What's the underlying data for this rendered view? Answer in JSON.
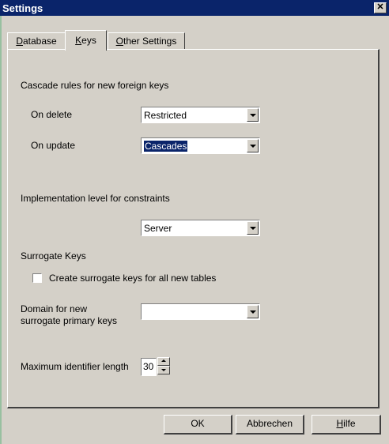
{
  "window": {
    "title": "Settings",
    "close_glyph": "✕"
  },
  "tabs": [
    {
      "label": "Database",
      "accel": "D",
      "rest": "atabase",
      "active": false
    },
    {
      "label": "Keys",
      "accel": "K",
      "rest": "eys",
      "active": true
    },
    {
      "label": "Other Settings",
      "accel": "O",
      "rest": "ther Settings",
      "active": false
    }
  ],
  "keys": {
    "cascade_heading": "Cascade rules for new foreign keys",
    "on_delete_label": "On delete",
    "on_delete_value": "Restricted",
    "on_update_label": "On update",
    "on_update_value": "Cascades",
    "impl_heading": "Implementation level for constraints",
    "impl_value": "Server",
    "surrogate_heading": "Surrogate Keys",
    "surrogate_checkbox_label": "Create surrogate keys for all new tables",
    "surrogate_checked": false,
    "domain_label_line1": "Domain for new",
    "domain_label_line2": "surrogate primary keys",
    "domain_value": "",
    "max_len_label": "Maximum identifier length",
    "max_len_value": "30"
  },
  "buttons": {
    "ok": "OK",
    "cancel": "Abbrechen",
    "help_accel": "H",
    "help_rest": "ilfe"
  },
  "icons": [
    "close-icon",
    "dropdown-arrow-icon",
    "spin-up-icon",
    "spin-down-icon"
  ]
}
